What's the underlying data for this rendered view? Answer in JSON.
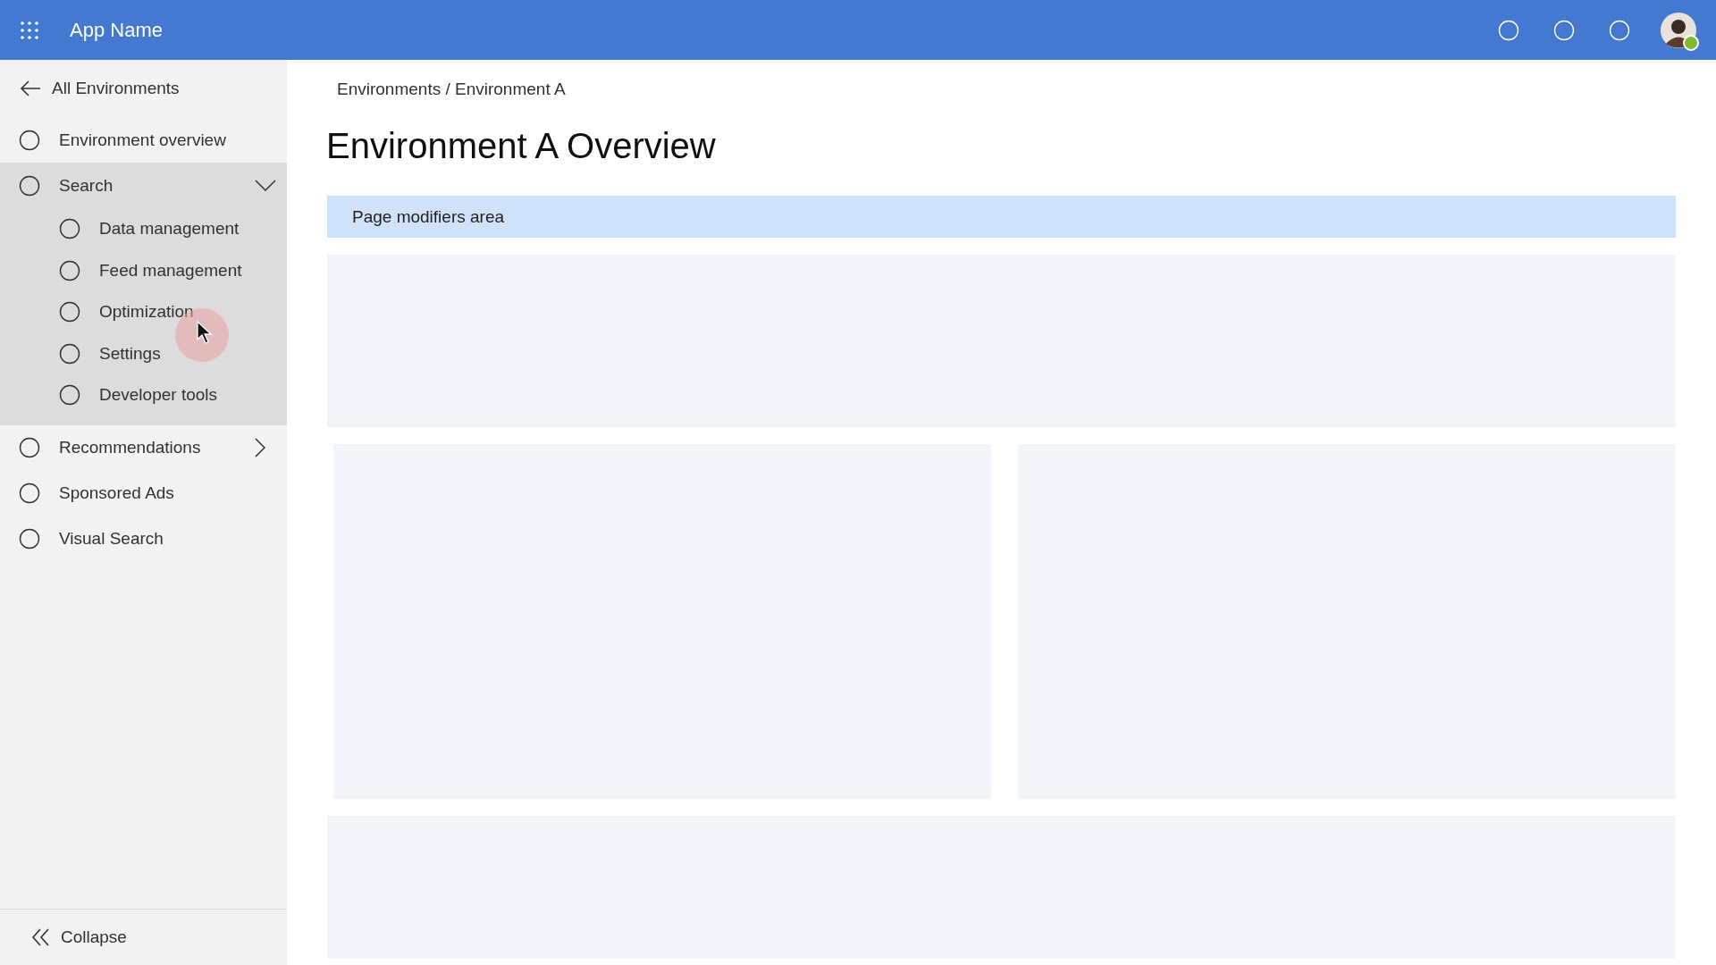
{
  "header": {
    "app_name": "App Name"
  },
  "sidebar": {
    "back_link": "All Environments",
    "items": [
      {
        "label": "Environment overview",
        "kind": "link"
      },
      {
        "label": "Search",
        "kind": "group",
        "expanded": true,
        "children": [
          {
            "label": "Data management"
          },
          {
            "label": "Feed management"
          },
          {
            "label": "Optimization"
          },
          {
            "label": "Settings"
          },
          {
            "label": "Developer tools"
          }
        ]
      },
      {
        "label": "Recommendations",
        "kind": "group",
        "expanded": false
      },
      {
        "label": "Sponsored Ads",
        "kind": "link"
      },
      {
        "label": "Visual Search",
        "kind": "link"
      }
    ],
    "collapse": "Collapse"
  },
  "breadcrumb": "Environments / Environment A",
  "title": "Environment A Overview",
  "modifiers_bar": "Page modifiers area"
}
